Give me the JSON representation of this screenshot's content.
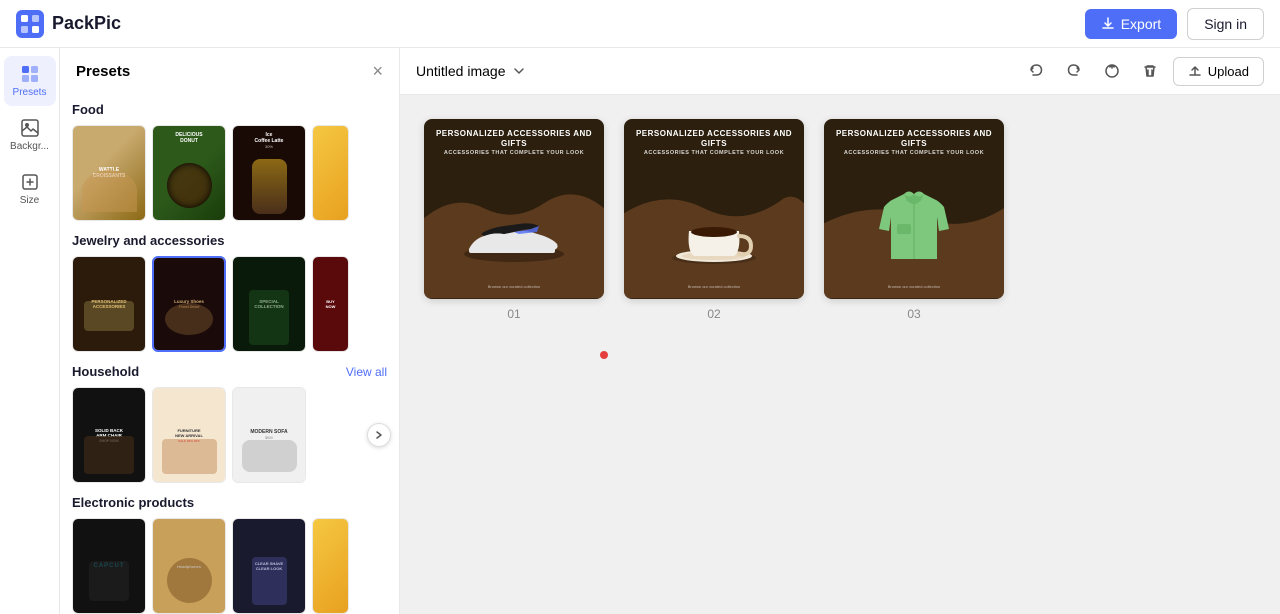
{
  "app": {
    "name": "PackPic",
    "logo_icon": "grid-icon"
  },
  "header": {
    "export_label": "Export",
    "signin_label": "Sign in"
  },
  "toolbar": {
    "items": [
      {
        "id": "presets",
        "label": "Presets",
        "active": true
      },
      {
        "id": "backgr",
        "label": "Backgr...",
        "active": false
      },
      {
        "id": "size",
        "label": "Size",
        "active": false
      }
    ]
  },
  "presets_panel": {
    "title": "Presets",
    "close_label": "×",
    "sections": [
      {
        "id": "food",
        "title": "Food",
        "view_all": null,
        "templates": [
          {
            "id": "f1",
            "bg": "brown",
            "label": "WATTLE CROISSANTS"
          },
          {
            "id": "f2",
            "bg": "green",
            "label": "DELICIOUS DONUT"
          },
          {
            "id": "f3",
            "bg": "dark-coffee",
            "label": "Ice Coffee Latte"
          },
          {
            "id": "f4",
            "bg": "yellow",
            "label": ""
          }
        ]
      },
      {
        "id": "jewelry",
        "title": "Jewelry and accessories",
        "view_all": null,
        "templates": [
          {
            "id": "j1",
            "bg": "dark-brown",
            "label": "Accessories"
          },
          {
            "id": "j2",
            "bg": "dark-wine",
            "label": "Luxury Shoes"
          },
          {
            "id": "j3",
            "bg": "dark-green",
            "label": "SPECIAL COLLECTION"
          },
          {
            "id": "j4",
            "bg": "red-dark",
            "label": "BUY NOW"
          }
        ]
      },
      {
        "id": "household",
        "title": "Household",
        "view_all": "View all",
        "templates": [
          {
            "id": "h1",
            "bg": "dark",
            "label": "Solid Back Arm Chair"
          },
          {
            "id": "h2",
            "bg": "cream",
            "label": "FURNITURE NEW ARRIVAL"
          },
          {
            "id": "h3",
            "bg": "white",
            "label": "Modern Sofa"
          }
        ]
      },
      {
        "id": "electronics",
        "title": "Electronic products",
        "view_all": null,
        "templates": [
          {
            "id": "e1",
            "bg": "dark",
            "label": "CAPCUT"
          },
          {
            "id": "e2",
            "bg": "brown-warm",
            "label": "Headphones"
          },
          {
            "id": "e3",
            "bg": "charcoal",
            "label": "CLEAR SHAVE CLEAR LOOK"
          },
          {
            "id": "e4",
            "bg": "yellow",
            "label": ""
          }
        ]
      }
    ]
  },
  "canvas": {
    "title": "Untitled image",
    "dropdown_icon": "chevron-down-icon",
    "undo_icon": "undo-icon",
    "redo_icon": "redo-icon",
    "refresh_icon": "refresh-icon",
    "delete_icon": "delete-icon",
    "upload_label": "Upload",
    "slides": [
      {
        "id": "01",
        "number": "01",
        "type": "sneaker",
        "top_title": "Personalized Accessories And Gifts",
        "sub": "Accessories That Complete Your Look"
      },
      {
        "id": "02",
        "number": "02",
        "type": "coffee",
        "top_title": "Personalized Accessories And Gifts",
        "sub": "Accessories That Complete Your Look"
      },
      {
        "id": "03",
        "number": "03",
        "type": "jacket",
        "top_title": "Personalized Accessories And Gifts",
        "sub": "Accessories That Complete Your Look"
      }
    ]
  }
}
